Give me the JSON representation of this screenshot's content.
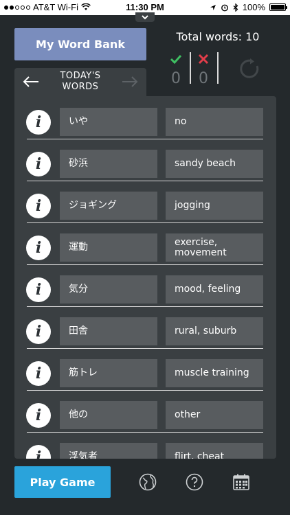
{
  "status_bar": {
    "carrier": "AT&T Wi-Fi",
    "time": "11:30 PM",
    "battery": "100%"
  },
  "header": {
    "word_bank_label": "My Word Bank",
    "total_words": "Total words: 10",
    "correct_count": "0",
    "wrong_count": "0",
    "colors": {
      "correct": "#3fbf62",
      "wrong": "#e23d4a",
      "word_bank": "#7a8dbd"
    }
  },
  "today": {
    "title_line1": "TODAY'S",
    "title_line2": "WORDS"
  },
  "words": [
    {
      "jp": "いや",
      "en": "no"
    },
    {
      "jp": "砂浜",
      "en": "sandy beach"
    },
    {
      "jp": "ジョギング",
      "en": "jogging"
    },
    {
      "jp": "運動",
      "en": "exercise, movement"
    },
    {
      "jp": "気分",
      "en": "mood, feeling"
    },
    {
      "jp": "田舎",
      "en": "rural, suburb"
    },
    {
      "jp": "筋トレ",
      "en": "muscle training"
    },
    {
      "jp": "他の",
      "en": "other"
    },
    {
      "jp": "浮気者",
      "en": "flirt, cheat"
    }
  ],
  "info_glyph": "i",
  "footer": {
    "play_label": "Play Game",
    "play_color": "#2aa3db",
    "icons": [
      "globe-icon",
      "help-icon",
      "calendar-icon"
    ]
  }
}
